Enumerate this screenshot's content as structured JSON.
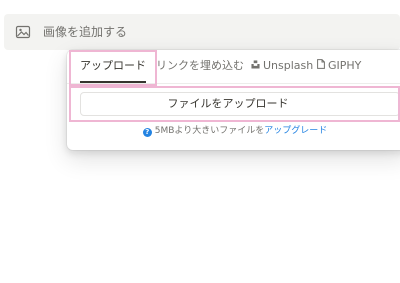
{
  "add_image": {
    "label": "画像を追加する",
    "icon": "image-icon"
  },
  "tabs": [
    {
      "label": "アップロード",
      "icon": ""
    },
    {
      "label": "リンクを埋め込む",
      "icon": ""
    },
    {
      "label": "Unsplash",
      "icon": "unsplash-icon"
    },
    {
      "label": "GIPHY",
      "icon": "file-icon"
    }
  ],
  "upload_button": {
    "label": "ファイルをアップロード"
  },
  "note": {
    "text": "5MBより大きいファイルを",
    "link": "アップグレード",
    "icon": "info-icon"
  },
  "colors": {
    "highlight": "#efb6d3",
    "link": "#2383e2",
    "text": "#37352f",
    "muted": "#73726e"
  }
}
